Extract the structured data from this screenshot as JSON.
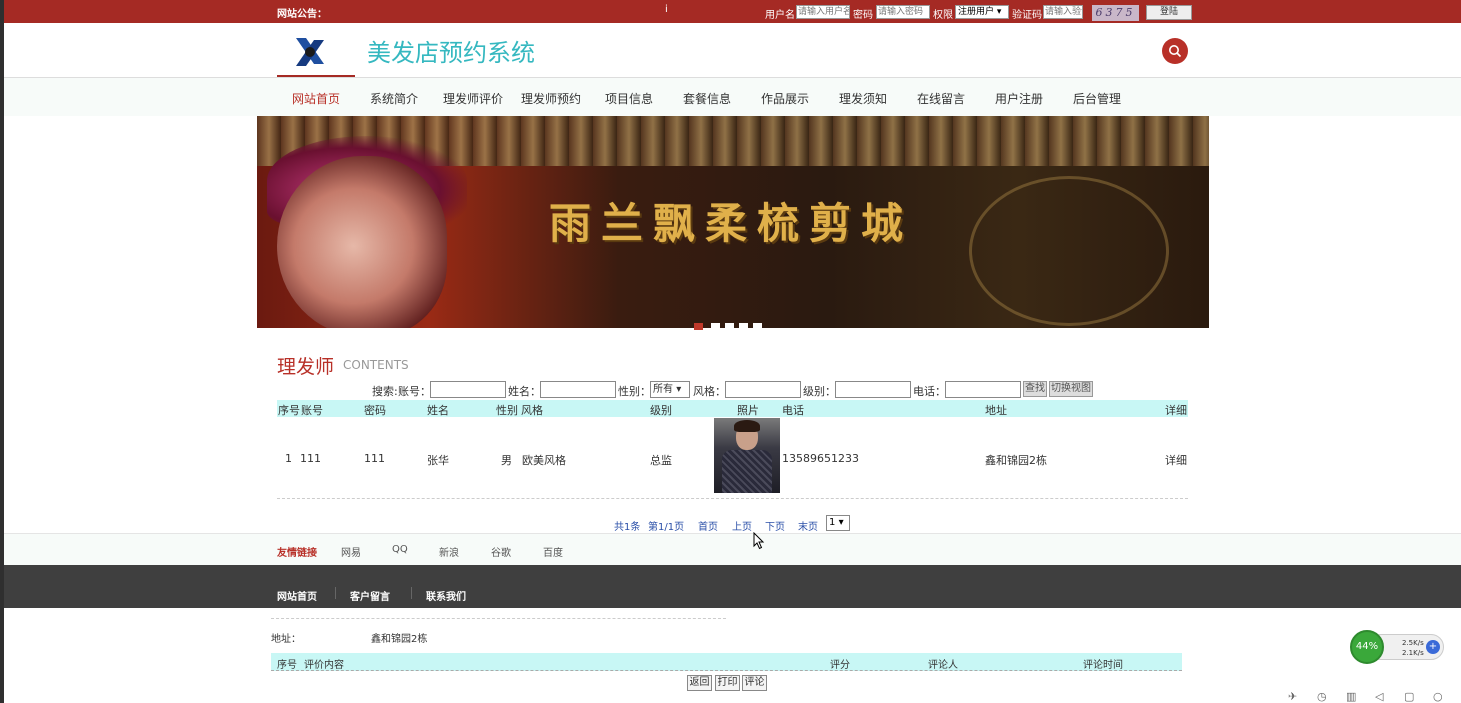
{
  "topbar": {
    "notice_label": "网站公告：",
    "info_icon": "i",
    "username_label": "用户名",
    "username_placeholder": "请输入用户名",
    "password_label": "密码",
    "password_placeholder": "请输入密码",
    "role_label": "权限",
    "role_value": "注册用户",
    "captcha_label": "验证码",
    "captcha_placeholder": "请输入验证码",
    "captcha_text": "6375",
    "login_button": "登陆"
  },
  "header": {
    "site_title": "美发店预约系统"
  },
  "nav": {
    "items": [
      {
        "label": "网站首页",
        "active": true
      },
      {
        "label": "系统简介"
      },
      {
        "label": "理发师评价"
      },
      {
        "label": "理发师预约"
      },
      {
        "label": "项目信息"
      },
      {
        "label": "套餐信息"
      },
      {
        "label": "作品展示"
      },
      {
        "label": "理发须知"
      },
      {
        "label": "在线留言"
      },
      {
        "label": "用户注册"
      },
      {
        "label": "后台管理"
      }
    ]
  },
  "banner": {
    "text": "雨兰飘柔梳剪城",
    "slide_count": 5,
    "active_slide": 1
  },
  "section": {
    "title": "理发师",
    "subtitle": "CONTENTS"
  },
  "search": {
    "prefix": "搜索:",
    "account_label": "账号：",
    "name_label": "姓名：",
    "gender_label": "性别：",
    "gender_value": "所有",
    "style_label": "风格：",
    "level_label": "级别：",
    "phone_label": "电话：",
    "search_button": "查找",
    "toggle_button": "切换视图"
  },
  "table": {
    "columns": [
      "序号",
      "账号",
      "密码",
      "姓名",
      "性别",
      "风格",
      "级别",
      "照片",
      "电话",
      "地址",
      "详细"
    ],
    "rows": [
      {
        "index": "1",
        "account": "111",
        "password": "111",
        "name": "张华",
        "gender": "男",
        "style": "欧美风格",
        "level": "总监",
        "phone": "13589651233",
        "address": "鑫和锦园2栋",
        "detail": "详细"
      }
    ]
  },
  "pager": {
    "total": "共1条",
    "page_info": "第1/1页",
    "first": "首页",
    "prev": "上页",
    "next": "下页",
    "last": "末页",
    "page_select": "1"
  },
  "links": {
    "heading": "友情链接",
    "items": [
      "网易",
      "QQ",
      "新浪",
      "谷歌",
      "百度"
    ]
  },
  "footer": {
    "items": [
      "网站首页",
      "客户留言",
      "联系我们"
    ]
  },
  "detail": {
    "address_label": "地址：",
    "address_value": "鑫和锦园2栋",
    "review_columns": [
      "序号",
      "评价内容",
      "评分",
      "评论人",
      "评论时间"
    ],
    "buttons": [
      "返回",
      "打印",
      "评论"
    ]
  },
  "widget": {
    "percent": "44%",
    "up_speed": "2.5K/s",
    "down_speed": "2.1K/s"
  },
  "colors": {
    "brand_red": "#a52a24",
    "title_cyan": "#35b8c0",
    "table_header": "#c8f7f5",
    "footer_dark": "#3f3f3f"
  }
}
